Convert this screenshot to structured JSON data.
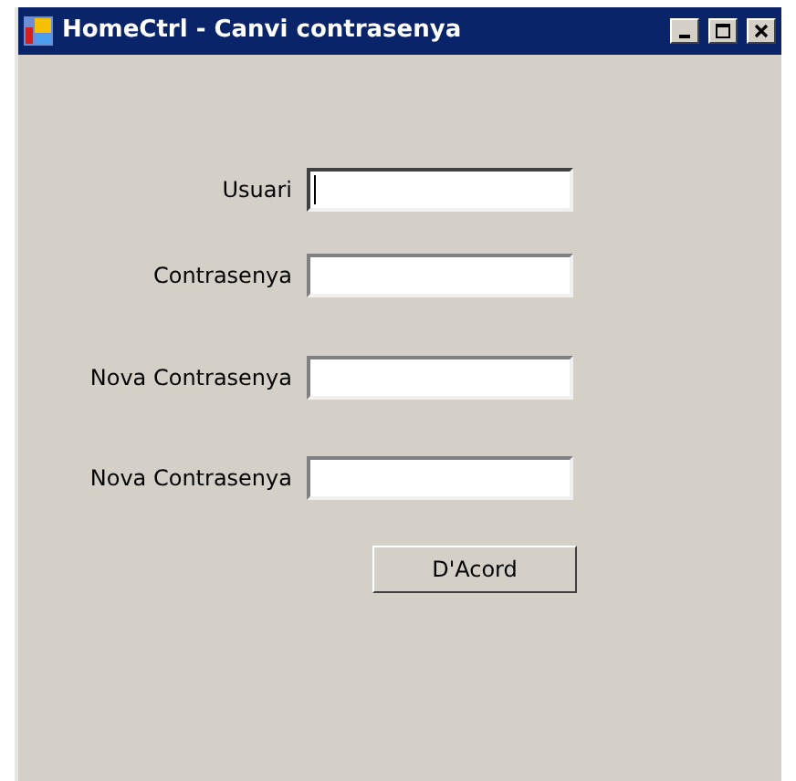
{
  "window": {
    "title": "HomeCtrl - Canvi contrasenya"
  },
  "fields": [
    {
      "label": "Usuari",
      "focused": true
    },
    {
      "label": "Contrasenya",
      "focused": false
    },
    {
      "label": "Nova Contrasenya",
      "focused": false
    },
    {
      "label": "Nova Contrasenya",
      "focused": false
    }
  ],
  "buttons": [
    "D'Acord"
  ]
}
